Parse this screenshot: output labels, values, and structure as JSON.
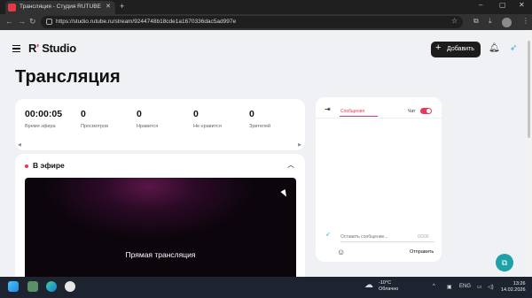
{
  "browser": {
    "tab_title": "Трансляция - Студия RUTUBE",
    "url": "https://studio.rutube.ru/stream/9244748b18cde1a1670336dac5ad997e"
  },
  "header": {
    "logo_prefix": "R",
    "logo_dot": "'",
    "logo_suffix": "Studio",
    "add_button": "Добавить"
  },
  "page_title": "Трансляция",
  "stats": [
    {
      "value": "00:00:05",
      "label": "Время эфира"
    },
    {
      "value": "0",
      "label": "Просмотров"
    },
    {
      "value": "0",
      "label": "Нравится"
    },
    {
      "value": "0",
      "label": "Не нравится"
    },
    {
      "value": "0",
      "label": "Зрителей"
    }
  ],
  "live": {
    "title": "В эфире",
    "player_text": "Прямая трансляция"
  },
  "chat": {
    "tab_messages": "Сообщения",
    "chat_label": "Чат",
    "chat_enabled": true,
    "input_placeholder": "Оставить сообщение...",
    "char_count": "0/200",
    "send_label": "Отправить"
  },
  "taskbar": {
    "temperature": "-10°C",
    "weather_desc": "Облачно",
    "lang": "ENG",
    "time": "13:26",
    "date": "14.02.2026"
  },
  "colors": {
    "accent": "#e8375a",
    "fab": "#1ea1a7"
  }
}
